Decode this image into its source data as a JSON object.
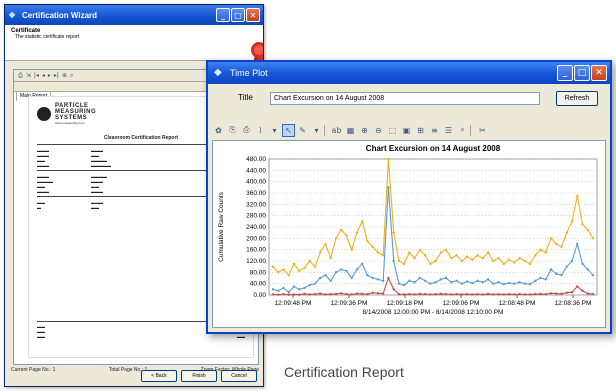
{
  "wizard": {
    "title": "Certification Wizard",
    "header_title": "Certificate",
    "header_sub": "The statistic certificate report",
    "tab": "Main Report",
    "company_lines": [
      "PARTICLE",
      "MEASURING",
      "SYSTEMS"
    ],
    "company_web": "www.pmeasuring.com",
    "report_title": "Cleanroom Certification Report",
    "status_page": "Current Page No.: 1",
    "status_total": "Total Page No.: 1",
    "status_zoom": "Zoom Factor: Whole Page",
    "btn_back": "< Back",
    "btn_finish": "Finish",
    "btn_cancel": "Cancel"
  },
  "timeplot": {
    "window_title": "Time Plot",
    "title_label": "Title",
    "title_value": "Chart Excursion on 14 August 2008",
    "refresh_label": "Refresh"
  },
  "caption": "Certification Report",
  "chart_data": {
    "type": "line",
    "title": "Chart Excursion on 14 August 2008",
    "ylabel": "Cumulative Raw Counts",
    "ylim": [
      0,
      480
    ],
    "yticks": [
      "480.00",
      "440.00",
      "400.00",
      "360.00",
      "320.00",
      "280.00",
      "240.00",
      "200.00",
      "160.00",
      "120.00",
      "80.00",
      "40.00",
      "0.00"
    ],
    "xticks": [
      "12:09:48 PM",
      "12:09:36 PM",
      "12:09:18 PM",
      "12:09:06 PM",
      "12:08:48 PM",
      "12:08:36 PM"
    ],
    "x_range_label": "8/14/2008 12:00:00 PM - 8/14/2008 12:10:00 PM",
    "series": [
      {
        "color": "#f0b020",
        "values": [
          100,
          80,
          90,
          70,
          110,
          85,
          95,
          120,
          100,
          150,
          180,
          130,
          200,
          230,
          210,
          160,
          220,
          260,
          190,
          170,
          150,
          140,
          480,
          220,
          120,
          110,
          150,
          130,
          160,
          140,
          110,
          120,
          150,
          160,
          130,
          140,
          120,
          135,
          125,
          140,
          130,
          150,
          120,
          130,
          110,
          125,
          115,
          130,
          120,
          110,
          140,
          160,
          150,
          200,
          180,
          170,
          220,
          260,
          350,
          250,
          230,
          200
        ]
      },
      {
        "color": "#5b9bd5",
        "values": [
          20,
          15,
          25,
          10,
          30,
          20,
          25,
          35,
          40,
          60,
          70,
          50,
          80,
          90,
          85,
          60,
          90,
          110,
          70,
          60,
          55,
          50,
          380,
          120,
          40,
          35,
          50,
          45,
          60,
          50,
          40,
          45,
          55,
          60,
          45,
          50,
          40,
          48,
          42,
          50,
          45,
          55,
          40,
          45,
          38,
          42,
          40,
          45,
          40,
          38,
          50,
          60,
          55,
          90,
          75,
          70,
          100,
          120,
          180,
          110,
          90,
          70
        ]
      },
      {
        "color": "#c0504d",
        "values": [
          2,
          1,
          3,
          1,
          2,
          1,
          4,
          2,
          3,
          5,
          2,
          3,
          4,
          6,
          3,
          2,
          5,
          4,
          3,
          8,
          6,
          5,
          60,
          20,
          3,
          2,
          3,
          2,
          4,
          3,
          2,
          3,
          4,
          3,
          2,
          3,
          2,
          3,
          2,
          3,
          2,
          4,
          2,
          3,
          2,
          3,
          2,
          3,
          2,
          2,
          3,
          4,
          3,
          6,
          5,
          4,
          8,
          10,
          30,
          15,
          5,
          3
        ]
      }
    ]
  }
}
